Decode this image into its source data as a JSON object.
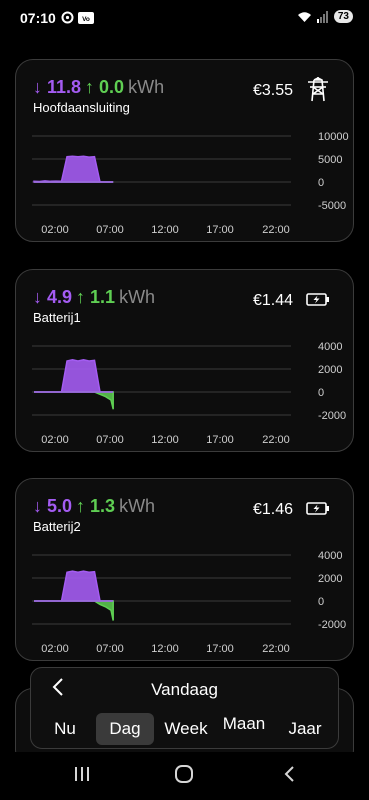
{
  "status": {
    "time": "07:10",
    "battery": "73"
  },
  "cards": [
    {
      "import": "↓ 11.8",
      "export": "↑ 0.0",
      "unit": "kWh",
      "name": "Hoofdaansluiting",
      "cost": "€3.55",
      "icon": "power-pylon-icon",
      "y_ticks": [
        "10000",
        "5000",
        "0",
        "-5000"
      ],
      "ylim": [
        -5000,
        10000
      ],
      "x_ticks": [
        "02:00",
        "07:00",
        "12:00",
        "17:00",
        "22:00"
      ]
    },
    {
      "import": "↓ 4.9",
      "export": "↑ 1.1",
      "unit": "kWh",
      "name": "Batterij1",
      "cost": "€1.44",
      "icon": "battery-charging-icon",
      "y_ticks": [
        "4000",
        "2000",
        "0",
        "-2000"
      ],
      "ylim": [
        -2000,
        4000
      ],
      "x_ticks": [
        "02:00",
        "07:00",
        "12:00",
        "17:00",
        "22:00"
      ]
    },
    {
      "import": "↓ 5.0",
      "export": "↑ 1.3",
      "unit": "kWh",
      "name": "Batterij2",
      "cost": "€1.46",
      "icon": "battery-charging-icon",
      "y_ticks": [
        "4000",
        "2000",
        "0",
        "-2000"
      ],
      "ylim": [
        -2000,
        4000
      ],
      "x_ticks": [
        "02:00",
        "07:00",
        "12:00",
        "17:00",
        "22:00"
      ]
    }
  ],
  "period": {
    "title": "Vandaag",
    "tabs": [
      "Nu",
      "Dag",
      "Week",
      "Maan",
      "Jaar"
    ],
    "active": "Dag"
  },
  "chart_data": [
    {
      "type": "area",
      "x": [
        0,
        0.5,
        1.0,
        1.5,
        2.0,
        2.5,
        3.0,
        3.5,
        4.0,
        4.5,
        5.0,
        5.5,
        6.0,
        6.5,
        7.0,
        7.2
      ],
      "series": [
        {
          "values": [
            150,
            100,
            250,
            150,
            200,
            150,
            5500,
            5600,
            5500,
            5600,
            5400,
            5500,
            0,
            0,
            0,
            0
          ]
        }
      ],
      "ylim": [
        -5000,
        10000
      ],
      "yticks": [
        10000,
        5000,
        0,
        -5000
      ],
      "xticks": [
        "02:00",
        "07:00",
        "12:00",
        "17:00",
        "22:00"
      ]
    },
    {
      "type": "area",
      "x": [
        0,
        0.5,
        1.0,
        1.5,
        2.0,
        2.5,
        3.0,
        3.5,
        4.0,
        4.5,
        5.0,
        5.5,
        6.0,
        6.5,
        7.0,
        7.2
      ],
      "series": [
        {
          "values": [
            0,
            0,
            0,
            0,
            0,
            0,
            2700,
            2800,
            2700,
            2800,
            2700,
            2750,
            -200,
            -400,
            -700,
            -1500
          ]
        }
      ],
      "ylim": [
        -2000,
        4000
      ],
      "yticks": [
        4000,
        2000,
        0,
        -2000
      ],
      "xticks": [
        "02:00",
        "07:00",
        "12:00",
        "17:00",
        "22:00"
      ]
    },
    {
      "type": "area",
      "x": [
        0,
        0.5,
        1.0,
        1.5,
        2.0,
        2.5,
        3.0,
        3.5,
        4.0,
        4.5,
        5.0,
        5.5,
        6.0,
        6.5,
        7.0,
        7.2
      ],
      "series": [
        {
          "values": [
            0,
            0,
            0,
            0,
            0,
            0,
            2500,
            2600,
            2500,
            2600,
            2500,
            2550,
            -300,
            -500,
            -800,
            -1700
          ]
        }
      ],
      "ylim": [
        -2000,
        4000
      ],
      "yticks": [
        4000,
        2000,
        0,
        -2000
      ],
      "xticks": [
        "02:00",
        "07:00",
        "12:00",
        "17:00",
        "22:00"
      ]
    }
  ],
  "colors": {
    "import": "#a45cf2",
    "export": "#5fcf53",
    "grid": "#3a3a3a"
  }
}
